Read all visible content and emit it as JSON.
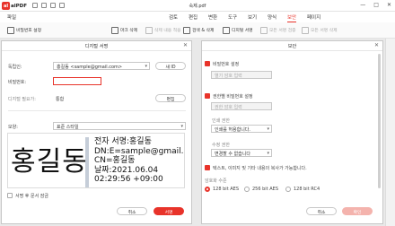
{
  "app": {
    "logo_text": "alPDF",
    "logo_mark": "al",
    "window_title": "숙제.pdf",
    "controls": [
      "—",
      "□",
      "✕"
    ]
  },
  "menu": {
    "file": "파일",
    "items": [
      "검토",
      "편집",
      "변환",
      "도구",
      "보기",
      "양식",
      "보안",
      "페이지"
    ],
    "active_index": 6
  },
  "toolbar": [
    {
      "label": "비밀번호 설정",
      "enabled": true,
      "icon": "lock-icon"
    },
    {
      "label": "마크 삭제",
      "enabled": true,
      "icon": "marker-icon"
    },
    {
      "label": "삭제 내용 적용",
      "enabled": false,
      "icon": "apply-icon"
    },
    {
      "label": "검색 & 삭제",
      "enabled": true,
      "icon": "search-icon"
    },
    {
      "label": "디지털 서명",
      "enabled": true,
      "icon": "signature-icon"
    },
    {
      "label": "모든 서명 검증",
      "enabled": false,
      "icon": "verify-icon"
    },
    {
      "label": "모든 서명 삭제",
      "enabled": false,
      "icon": "trash-icon"
    }
  ],
  "sign_dialog": {
    "title": "디지털 서명",
    "id_label": "독립인:",
    "id_value": "홍길동 <sample@gmail.com>",
    "new_button": "새 ID",
    "password_label": "비밀번호:",
    "password_value": "",
    "appearance_label": "디지털 필요가:",
    "appearance_value": "통합",
    "appearance_button": "편집",
    "style_label": "모양:",
    "style_value": "표준 스타일",
    "preview": {
      "name": "홍길동",
      "detail_lines": [
        "전자 서명:홍길동",
        "DN:E=sample@gmail.com,",
        "CN=홍길동",
        "날짜:2021.06.04",
        "02:29:56 +09:00"
      ]
    },
    "lock_checkbox": "서명 후 문서 잠금",
    "lock_checked": false,
    "cancel": "취소",
    "sign": "서명"
  },
  "security_dialog": {
    "title": "보안",
    "open_pw_label": "비밀번호 설정",
    "open_pw_checked": true,
    "open_pw_placeholder": "열기 암호 입력",
    "perm_label": "권한별 비밀번호 설정",
    "perm_checked": true,
    "perm_placeholder": "권한 암호 입력",
    "print_label": "인쇄 권한",
    "print_value": "인쇄를 허용합니다.",
    "edit_label": "수정 권한",
    "edit_value": "변경할 수 없습니다",
    "copy_label": "텍스트, 이미지 및 기타 내용의 복사가 가능합니다.",
    "copy_checked": true,
    "encrypt_label": "암호화 수준",
    "encrypt_options": [
      "128 bit AES",
      "256 bit AES",
      "128 bit RC4"
    ],
    "encrypt_selected": 0,
    "cancel": "취소",
    "ok": "확인"
  }
}
